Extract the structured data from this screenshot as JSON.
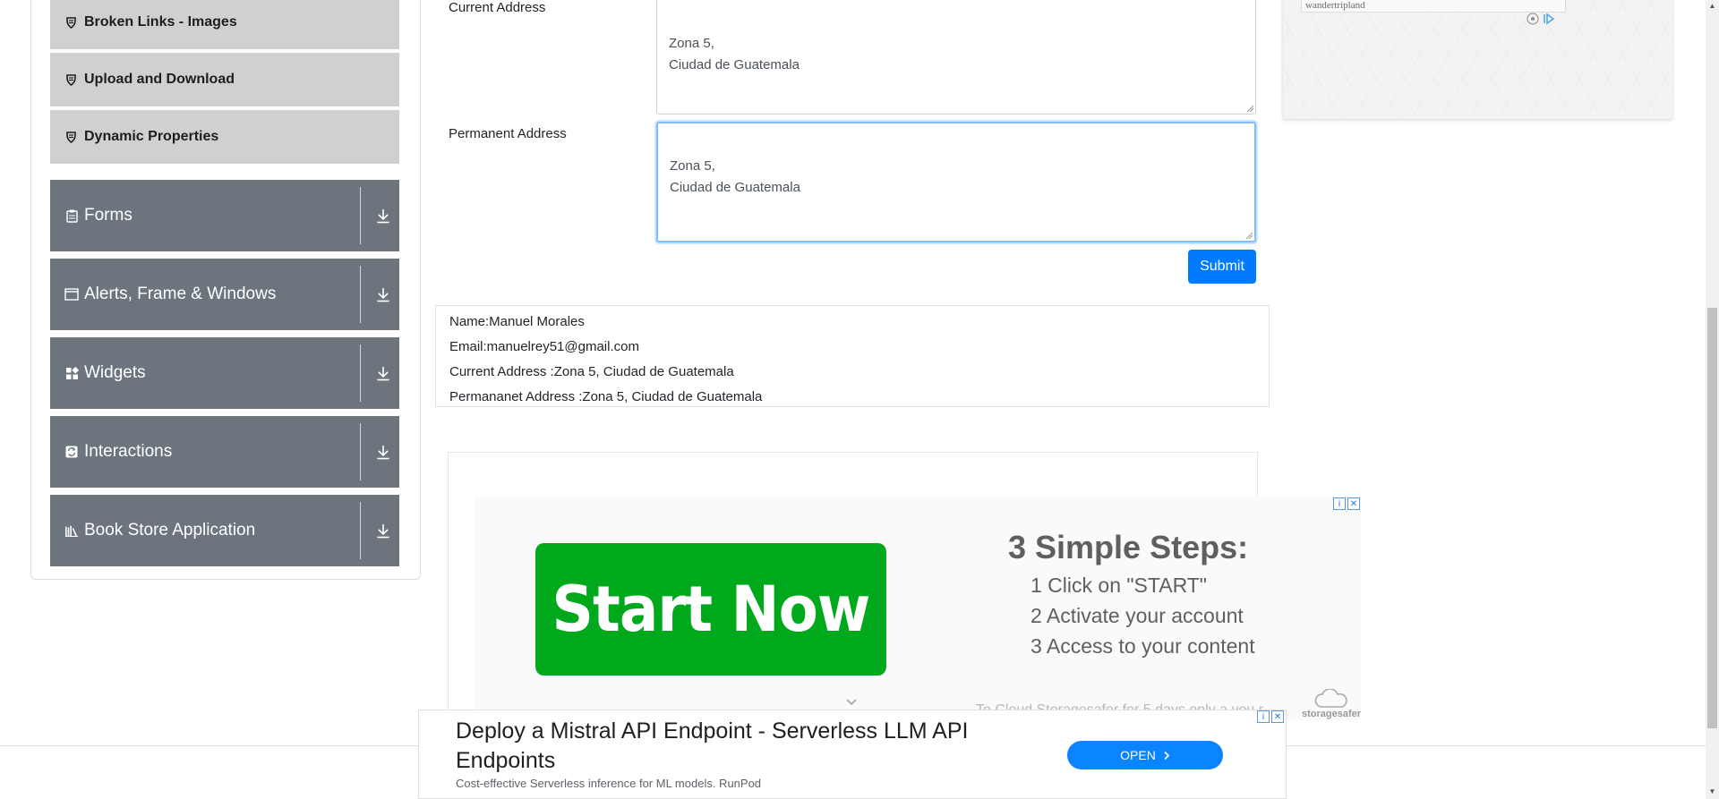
{
  "sidebar": {
    "sub_items": [
      {
        "label": "Broken Links - Images",
        "icon": "shield-icon"
      },
      {
        "label": "Upload and Download",
        "icon": "shield-icon"
      },
      {
        "label": "Dynamic Properties",
        "icon": "shield-icon"
      }
    ],
    "groups": [
      {
        "label": "Forms",
        "icon": "clipboard-icon"
      },
      {
        "label": "Alerts, Frame & Windows",
        "icon": "window-icon"
      },
      {
        "label": "Widgets",
        "icon": "widgets-icon"
      },
      {
        "label": "Interactions",
        "icon": "interactions-icon"
      },
      {
        "label": "Book Store Application",
        "icon": "books-icon"
      }
    ]
  },
  "form": {
    "current_address_label": "Current Address",
    "current_address_value": "Zona 5,\nCiudad de Guatemala",
    "permanent_address_label": "Permanent Address",
    "permanent_address_value": "Zona 5,\nCiudad de Guatemala",
    "submit_label": "Submit"
  },
  "output": {
    "name": "Name:Manuel Morales",
    "email": "Email:manuelrey51@gmail.com",
    "current_address": "Current Address :Zona 5, Ciudad de Guatemala",
    "permanent_address": "Permananet Address :Zona 5, Ciudad de Guatemala"
  },
  "ad_main": {
    "button_text": "Start Now",
    "steps_title": "3 Simple Steps:",
    "steps": [
      "1 Click on \"START\"",
      "2 Activate your account",
      "3 Access to your content"
    ],
    "faded_text": "To Cloud Storagesafer for 5 days only a you r",
    "brand": "storagesafer"
  },
  "ad_right": {
    "field_text": "wandertripland"
  },
  "ad_bottom": {
    "headline": "Deploy a Mistral API Endpoint - Serverless LLM API Endpoints",
    "subtext": "Cost-effective Serverless inference for ML models. RunPod",
    "button_label": "OPEN"
  },
  "colors": {
    "sidebar_group_bg": "#6c757d",
    "sidebar_subitem_bg": "#d0d0d0",
    "primary": "#007bff",
    "start_green": "#00a81c"
  }
}
